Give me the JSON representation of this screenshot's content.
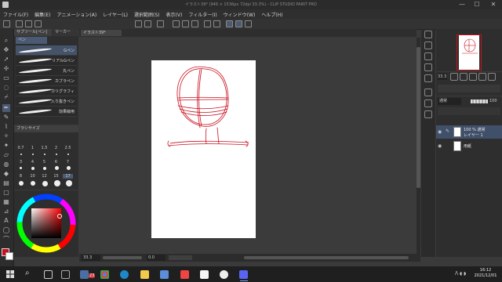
{
  "title_bar": {
    "title": "イラスト39* (946 × 1536px 72dpi 33.3%) - CLIP STUDIO PAINT PRO",
    "minimize": "—",
    "maximize": "☐",
    "close": "✕"
  },
  "menu": [
    "ファイル(F)",
    "編集(E)",
    "アニメーション(A)",
    "レイヤー(L)",
    "選択範囲(S)",
    "表示(V)",
    "フィルター(I)",
    "ウィンドウ(W)",
    "ヘルプ(H)"
  ],
  "subtool": {
    "tabs": [
      "サブツール[ペン]",
      "マーカー"
    ],
    "pen_tab": "ペン",
    "brushes": [
      "Gペン",
      "リアルGペン",
      "丸ペン",
      "カブラペン",
      "カリグラフィ",
      "入り抜きペン",
      "効果線用"
    ]
  },
  "brush_size": {
    "tab": "ブラシサイズ",
    "sizes": [
      "0.7",
      "1",
      "1.5",
      "2",
      "2.5",
      "3",
      "4",
      "5",
      "6",
      "7",
      "8",
      "10",
      "12",
      "15",
      "17"
    ],
    "selected": "17"
  },
  "canvas": {
    "tab_label": "イラスト39*",
    "zoom": "33.3",
    "angle": "0.0"
  },
  "layers": {
    "blend_mode": "通常",
    "opacity": "100",
    "items": [
      {
        "line1": "100 % 通常",
        "line2": "レイヤー 1"
      },
      {
        "line1": "用紙",
        "line2": ""
      }
    ]
  },
  "taskbar": {
    "search": "⌕",
    "badge": "23",
    "time": "16:12",
    "date": "2021/12/01"
  },
  "colors": {
    "main": "#c9101a",
    "sketch": "#c8101e",
    "paper": "#ffffff"
  }
}
